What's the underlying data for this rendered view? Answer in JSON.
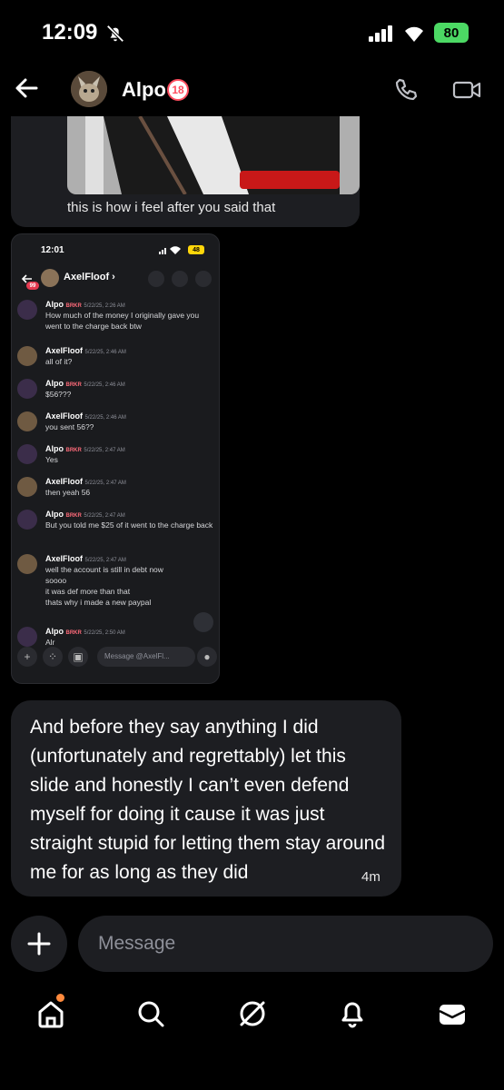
{
  "status_bar": {
    "time": "12:09",
    "battery": "80"
  },
  "header": {
    "name": "Alpo",
    "age_badge": "18"
  },
  "top_message": {
    "caption": "this is how i feel after you said that"
  },
  "screenshot": {
    "time": "12:01",
    "battery": "48",
    "badge": "99",
    "channel": "AxelFloof ›",
    "messages": [
      {
        "author": "Alpo",
        "tag": "BRKR",
        "time": "5/22/25, 2:26 AM",
        "text": "How much of the money I originally gave you went to the charge back btw"
      },
      {
        "author": "AxelFloof",
        "tag": "",
        "time": "5/22/25, 2:46 AM",
        "text": "all of it?"
      },
      {
        "author": "Alpo",
        "tag": "BRKR",
        "time": "5/22/25, 2:46 AM",
        "text": "$56???"
      },
      {
        "author": "AxelFloof",
        "tag": "",
        "time": "5/22/25, 2:46 AM",
        "text": "you sent 56??"
      },
      {
        "author": "Alpo",
        "tag": "BRKR",
        "time": "5/22/25, 2:47 AM",
        "text": "Yes"
      },
      {
        "author": "AxelFloof",
        "tag": "",
        "time": "5/22/25, 2:47 AM",
        "text": "then yeah 56"
      },
      {
        "author": "Alpo",
        "tag": "BRKR",
        "time": "5/22/25, 2:47 AM",
        "text": "But you told me $25 of it went to the charge back"
      },
      {
        "author": "AxelFloof",
        "tag": "",
        "time": "5/22/25, 2:47 AM",
        "text": "well the account is still in debt now\nsoooo\nit was def more than that\nthats why i made a new paypal"
      },
      {
        "author": "Alpo",
        "tag": "BRKR",
        "time": "5/22/25, 2:50 AM",
        "text": "Alr"
      }
    ],
    "input_placeholder": "Message @AxelFl..."
  },
  "bubble": {
    "text": "And before they say anything I did (unfortunately and regrettably) let this slide and honestly I can’t even defend myself for doing it cause it was just straight stupid for letting them stay around me for as long as they did",
    "time": "4m"
  },
  "composer": {
    "placeholder": "Message"
  },
  "nav": {
    "items": [
      "home-icon",
      "search-icon",
      "discover-icon",
      "notifications-icon",
      "inbox-icon"
    ]
  },
  "colors": {
    "bg": "#000000",
    "bubble": "#1d1e22",
    "battery": "#4cd964",
    "accent": "#ff4d5e",
    "home_dot": "#ff8a3d"
  }
}
